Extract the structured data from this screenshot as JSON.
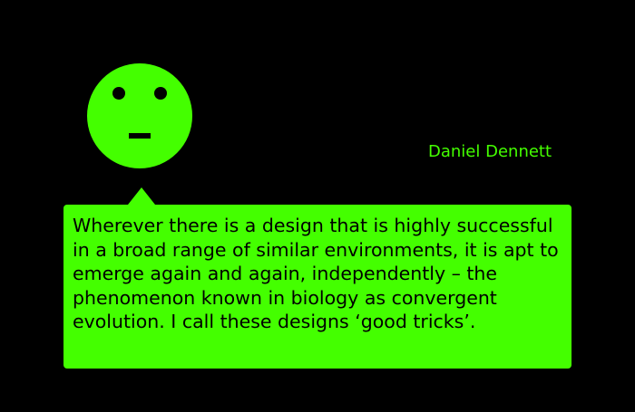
{
  "speaker": {
    "name": "Daniel Dennett",
    "face_icon": "neutral-face-icon",
    "color": "#44ff00"
  },
  "speech_bubble": {
    "text": "Wherever there is a design that is highly successful in a broad range of similar environments, it is apt to emerge again and again, independently – the phenomenon known in biology as convergent evolution. I call these designs ‘good tricks’.",
    "background": "#44ff00",
    "text_color": "#000000"
  },
  "background": "#000000"
}
